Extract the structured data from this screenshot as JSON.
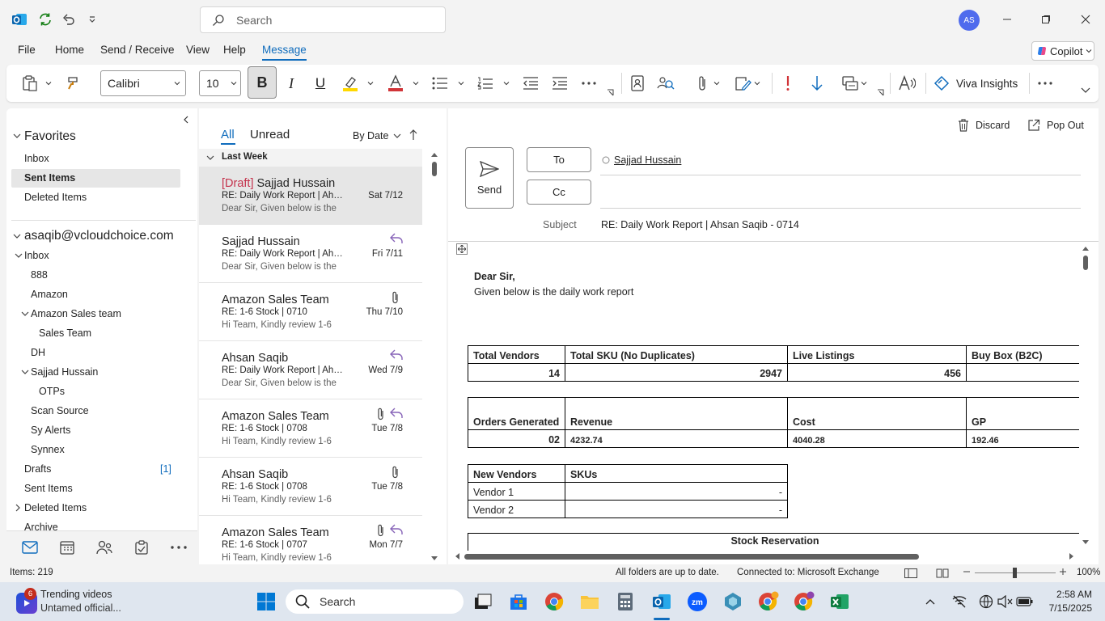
{
  "titlebar": {
    "search_placeholder": "Search",
    "avatar_initials": "AS"
  },
  "menu": {
    "items": [
      "File",
      "Home",
      "Send / Receive",
      "View",
      "Help",
      "Message"
    ],
    "active": "Message",
    "copilot": "Copilot"
  },
  "ribbon": {
    "font_name": "Calibri",
    "font_size": "10",
    "bold": "B",
    "italic": "I",
    "underline": "U",
    "viva": "Viva Insights"
  },
  "nav": {
    "favorites": "Favorites",
    "fav_items": [
      "Inbox",
      "Sent Items",
      "Deleted Items"
    ],
    "account": "asaqib@vcloudchoice.com",
    "inbox": "Inbox",
    "folders": [
      "888",
      "Amazon",
      "Amazon Sales team",
      "Sales Team",
      "DH",
      "Sajjad Hussain",
      "OTPs",
      "Scan Source",
      "Sy Alerts",
      "Synnex",
      "Drafts",
      "Sent Items",
      "Deleted Items",
      "Archive"
    ],
    "drafts_count": "[1]"
  },
  "list": {
    "filters": {
      "all": "All",
      "unread": "Unread",
      "sort": "By Date"
    },
    "group": "Last Week",
    "items": [
      {
        "draft": "[Draft]",
        "from": " Sajjad Hussain",
        "subject": "RE: Daily Work Report | Ahsan",
        "preview": "Dear Sir,  Given below is the",
        "date": "Sat 7/12"
      },
      {
        "from": "Sajjad Hussain",
        "subject": "RE: Daily Work Report | Ahsan",
        "preview": "Dear Sir,  Given below is the",
        "date": "Fri 7/11"
      },
      {
        "from": "Amazon Sales Team",
        "subject": "RE: 1-6 Stock | 0710",
        "preview": "Hi Team,  Kindly review 1-6",
        "date": "Thu 7/10"
      },
      {
        "from": "Ahsan Saqib",
        "subject": "RE: Daily Work Report | Ahsan",
        "preview": "Dear Sir,  Given below is the",
        "date": "Wed 7/9"
      },
      {
        "from": "Amazon Sales Team",
        "subject": "RE: 1-6 Stock | 0708",
        "preview": "Hi Team,  Kindly review 1-6",
        "date": "Tue 7/8"
      },
      {
        "from": "Ahsan Saqib",
        "subject": "RE: 1-6 Stock | 0708",
        "preview": "Hi Team,  Kindly review 1-6",
        "date": "Tue 7/8"
      },
      {
        "from": "Amazon Sales Team",
        "subject": "RE: 1-6 Stock | 0707",
        "preview": "Hi Team,  Kindly review 1-6",
        "date": "Mon 7/7"
      }
    ]
  },
  "compose": {
    "discard": "Discard",
    "popout": "Pop Out",
    "send": "Send",
    "to": "To",
    "cc": "Cc",
    "recipient": "Sajjad Hussain",
    "subject_label": "Subject",
    "subject": "RE: Daily Work Report | Ahsan Saqib - 0714",
    "greeting": "Dear Sir,",
    "intro": "Given below is the daily work report",
    "t1": {
      "h": [
        "Total Vendors",
        "Total SKU (No Duplicates)",
        "Live Listings",
        "Buy Box (B2C)"
      ],
      "v": [
        "14",
        "2947",
        "456",
        ""
      ]
    },
    "t2": {
      "h": [
        "Orders Generated",
        "Revenue",
        "Cost",
        "GP"
      ],
      "v": [
        "02",
        "4232.74",
        "4040.28",
        "192.46"
      ]
    },
    "t3": {
      "h": [
        "New Vendors",
        "SKUs"
      ],
      "rows": [
        [
          "Vendor 1",
          "-"
        ],
        [
          "Vendor 2",
          "-"
        ]
      ]
    },
    "t4": {
      "h": "Stock Reservation"
    }
  },
  "status": {
    "items": "Items: 219",
    "sync": "All folders are up to date.",
    "connection": "Connected to: Microsoft Exchange",
    "zoom": "100%"
  },
  "taskbar": {
    "widget_badge": "6",
    "widget_title": "Trending videos",
    "widget_sub": "Untamed official...",
    "search": "Search",
    "time": "2:58 AM",
    "date": "7/15/2025"
  }
}
